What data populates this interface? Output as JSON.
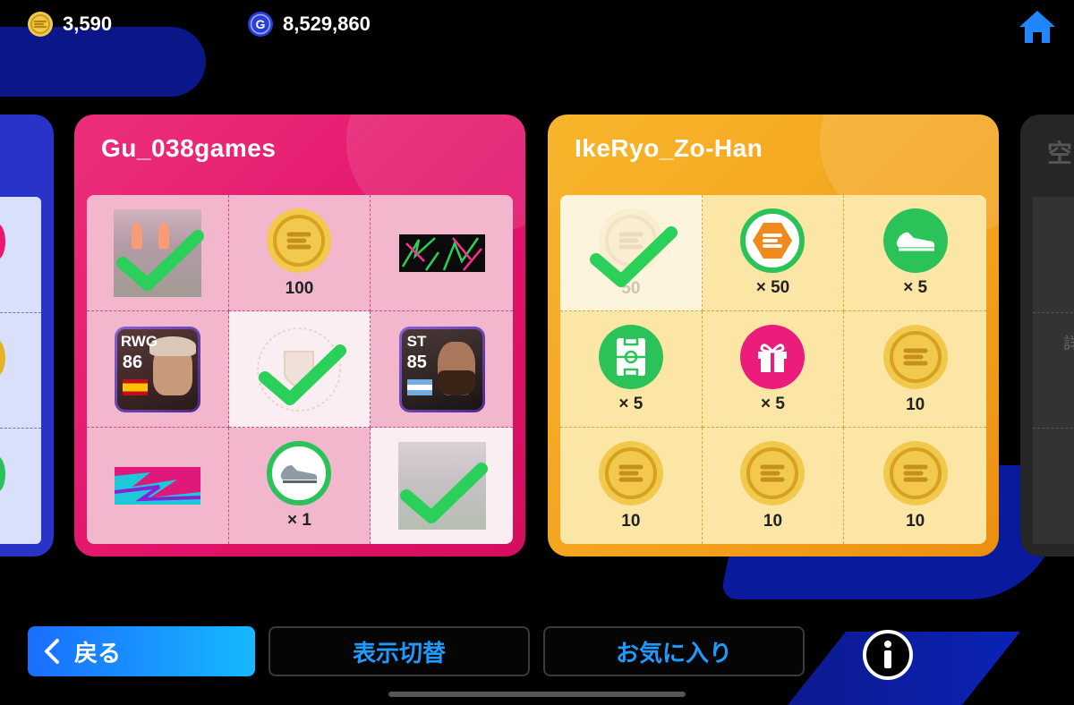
{
  "top_bar": {
    "ecoin_amount": "3,590",
    "gp_amount": "8,529,860",
    "ecoin_icon": "ecoin-icon",
    "gp_icon": "gp-icon",
    "home_icon": "home-icon"
  },
  "cards": [
    {
      "owner": "Gu_038games",
      "theme": "pink",
      "cells": [
        {
          "type": "photo",
          "label": "",
          "claimed": true
        },
        {
          "type": "coin",
          "label": "100",
          "claimed": false
        },
        {
          "type": "banner",
          "label": "",
          "claimed": false
        },
        {
          "type": "player",
          "position": "RWG",
          "rating": "86",
          "flag": "spain",
          "label": "",
          "claimed": false
        },
        {
          "type": "emblem",
          "label": "",
          "claimed": true
        },
        {
          "type": "player",
          "position": "ST",
          "rating": "85",
          "flag": "argentina",
          "label": "",
          "claimed": false
        },
        {
          "type": "banner2",
          "label": "",
          "claimed": false
        },
        {
          "type": "boot",
          "label": "× 1",
          "claimed": false
        },
        {
          "type": "photo",
          "label": "",
          "claimed": true
        }
      ]
    },
    {
      "owner": "IkeRyo_Zo-Han",
      "theme": "orange",
      "cells": [
        {
          "type": "coin-faded",
          "label": "50",
          "claimed": true
        },
        {
          "type": "orange-ecoin",
          "label": "× 50",
          "claimed": false
        },
        {
          "type": "green-boot",
          "label": "× 5",
          "claimed": false
        },
        {
          "type": "pitch",
          "label": "× 5",
          "claimed": false
        },
        {
          "type": "gift",
          "label": "× 5",
          "claimed": false
        },
        {
          "type": "coin",
          "label": "10",
          "claimed": false
        },
        {
          "type": "coin",
          "label": "10",
          "claimed": false
        },
        {
          "type": "coin",
          "label": "10",
          "claimed": false
        },
        {
          "type": "coin",
          "label": "10",
          "claimed": false
        }
      ]
    }
  ],
  "right_partial_card_char": "空",
  "right_partial_card_char2": "詳",
  "bottom": {
    "back_label": "戻る",
    "toggle_label": "表示切替",
    "favorite_label": "お気に入り",
    "info_icon": "info-icon"
  },
  "colors": {
    "pink": "#e8186d",
    "orange": "#f3a21c",
    "accent_blue": "#1e9bff",
    "check_green": "#2bd05a"
  }
}
